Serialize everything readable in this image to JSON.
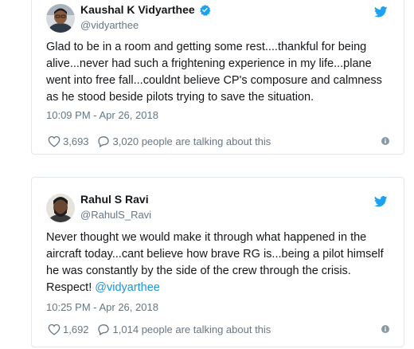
{
  "tweets": [
    {
      "name": "Kaushal K Vidyarthee",
      "handle": "@vidyarthee",
      "verified": true,
      "text": "Glad to be in a room and getting some rest....thankful for being alive...never had such a frightening experience in my life...plane went into free fall...couldnt believe CP's composure and calmness as he stood beside pilots trying to save the situation.",
      "time": "10:09 PM - Apr 26, 2018",
      "likes": "3,693",
      "talking": "3,020 people are talking about this"
    },
    {
      "name": "Rahul S Ravi",
      "handle": "@RahulS_Ravi",
      "verified": false,
      "text_before_mention": "Never thought we would make it through what happened in the aircraft today...cant believe how brave RG is...being a pilot himself he was constantly by the side of the crew through the crisis. Respect! ",
      "mention": "@vidyarthee",
      "time": "10:25 PM - Apr 26, 2018",
      "likes": "1,692",
      "talking": "1,014 people are talking about this"
    }
  ],
  "colors": {
    "twitter_blue": "#1da1f2",
    "link": "#1b95e0",
    "muted": "#657786",
    "border": "#e1e8ed"
  },
  "icons": [
    "verified-badge-icon",
    "twitter-bird-icon",
    "heart-icon",
    "comment-icon",
    "info-icon"
  ]
}
